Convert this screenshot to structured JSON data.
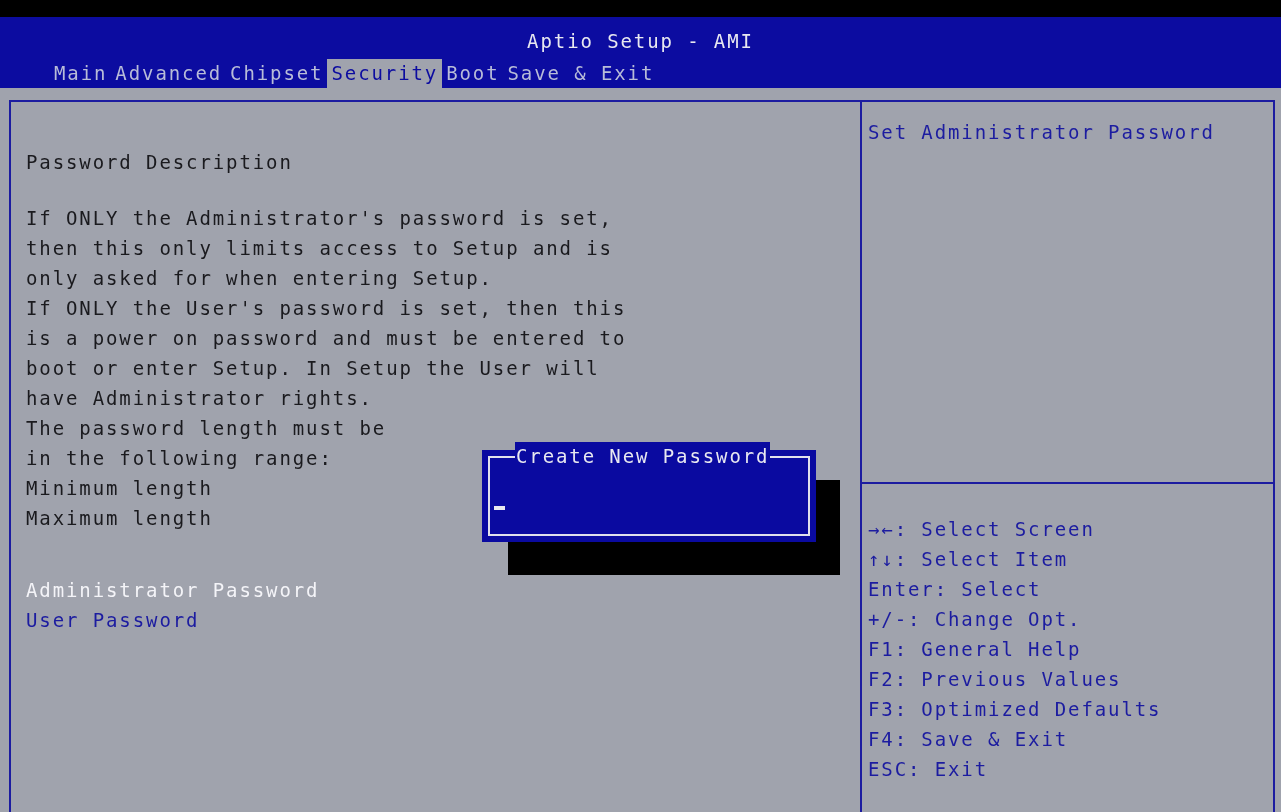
{
  "window": {
    "title": "Aptio Setup - AMI"
  },
  "tabs": [
    {
      "label": "Main",
      "selected": false
    },
    {
      "label": "Advanced",
      "selected": false
    },
    {
      "label": "Chipset",
      "selected": false
    },
    {
      "label": "Security",
      "selected": true
    },
    {
      "label": "Boot",
      "selected": false
    },
    {
      "label": "Save & Exit",
      "selected": false
    }
  ],
  "section_title": "Password Description",
  "description_lines": [
    "If ONLY the Administrator's password is set,",
    "then this only limits access to Setup and is",
    "only asked for when entering Setup.",
    "If ONLY the User's password is set, then this",
    "is a power on password and must be entered to",
    "boot or enter Setup. In Setup the User will",
    "have Administrator rights.",
    "The password length must be",
    "in the following range:",
    "Minimum length",
    "Maximum length"
  ],
  "menu_items": [
    {
      "label": "Administrator Password",
      "selected": true
    },
    {
      "label": "User Password",
      "selected": false
    }
  ],
  "help_text": "Set Administrator Password",
  "key_help": [
    "→←: Select Screen",
    "↑↓: Select Item",
    "Enter: Select",
    "+/-: Change Opt.",
    "F1: General Help",
    "F2: Previous Values",
    "F3: Optimized Defaults",
    "F4: Save & Exit",
    "ESC: Exit"
  ],
  "dialog": {
    "title": "Create New Password"
  }
}
